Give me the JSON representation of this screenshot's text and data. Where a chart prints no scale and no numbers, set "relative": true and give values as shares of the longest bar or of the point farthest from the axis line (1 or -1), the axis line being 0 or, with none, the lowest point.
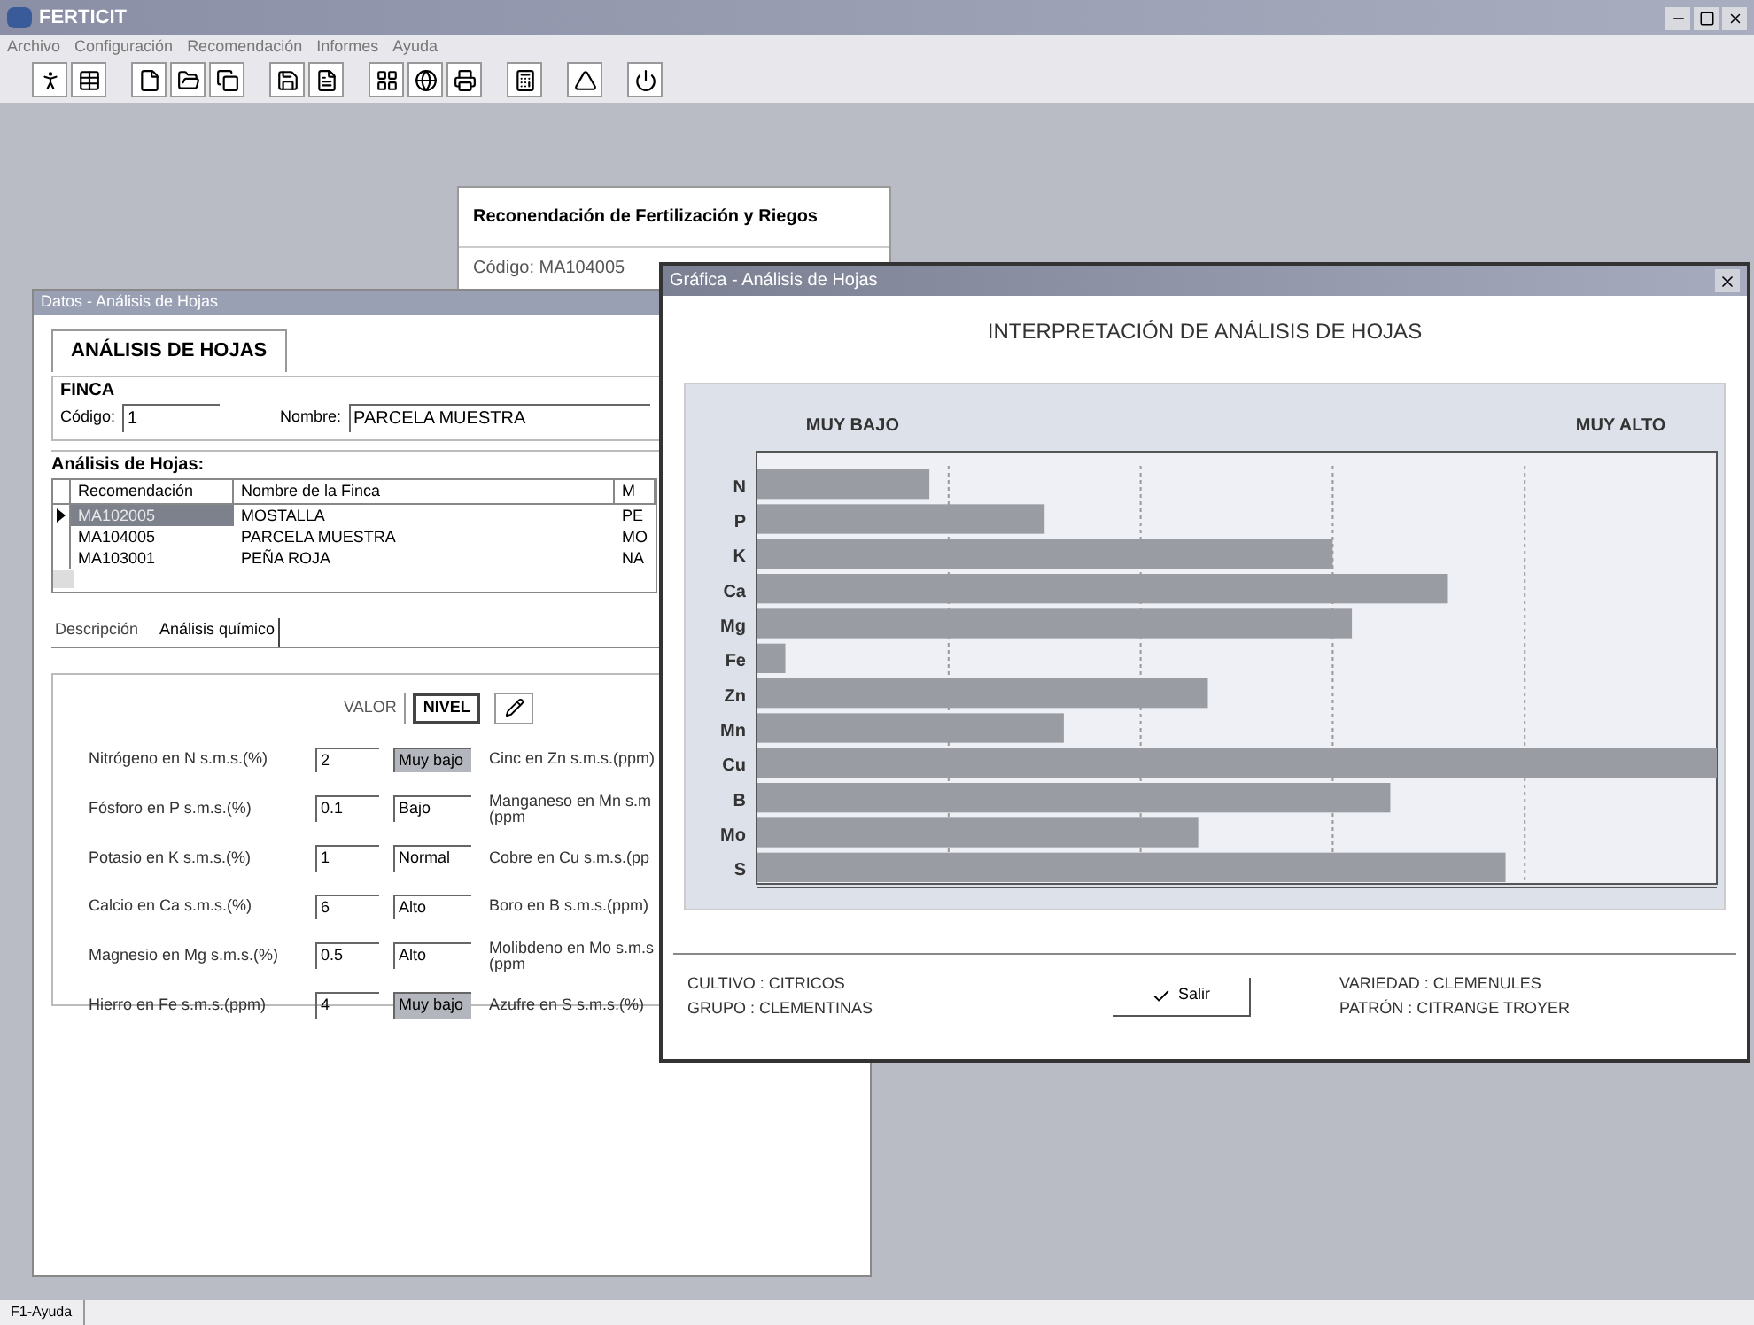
{
  "app": {
    "title": "FERTICIT",
    "menu": [
      "Archivo",
      "Configuración",
      "Recomendación",
      "Informes",
      "Ayuda"
    ]
  },
  "background_panel": {
    "title": "Reconendación de Fertilización y Riegos",
    "code_label": "Código: MA104005"
  },
  "data_window": {
    "title": "Datos - Análisis de Hojas",
    "header_tab": "ANÁLISIS DE HOJAS",
    "finca": {
      "legend": "FINCA",
      "code_label": "Código:",
      "code_value": "1",
      "name_label": "Nombre:",
      "name_value": "PARCELA MUESTRA"
    },
    "analyses": {
      "legend": "Análisis de Hojas:",
      "columns": [
        "Recomendación",
        "Nombre de la Finca",
        "M"
      ],
      "rows": [
        {
          "cells": [
            "MA102005",
            "MOSTALLA",
            "PE"
          ],
          "selected": true
        },
        {
          "cells": [
            "MA104005",
            "PARCELA MUESTRA",
            "MO"
          ],
          "selected": false
        },
        {
          "cells": [
            "MA103001",
            "PEÑA ROJA",
            "NA"
          ],
          "selected": false
        }
      ]
    },
    "tabs": [
      {
        "label": "Descripción",
        "selected": false
      },
      {
        "label": "Análisis químico",
        "selected": true
      }
    ],
    "column_buttons": [
      {
        "label": "VALOR",
        "pressed": false
      },
      {
        "label": "NIVEL",
        "pressed": true
      }
    ],
    "nutrients": [
      {
        "label": "Nitrógeno en N s.m.s.(%)",
        "value": "2",
        "level": "Muy bajo",
        "highlighted": true,
        "right_label": "Cinc en Zn s.m.s.(ppm)"
      },
      {
        "label": "Fósforo en P s.m.s.(%)",
        "value": "0.1",
        "level": "Bajo",
        "highlighted": false,
        "right_label": "Manganeso en Mn s.m (ppm"
      },
      {
        "label": "Potasio en K s.m.s.(%)",
        "value": "1",
        "level": "Normal",
        "highlighted": false,
        "right_label": "Cobre en Cu s.m.s.(pp"
      },
      {
        "label": "Calcio en Ca s.m.s.(%)",
        "value": "6",
        "level": "Alto",
        "highlighted": false,
        "right_label": "Boro en B s.m.s.(ppm)"
      },
      {
        "label": "Magnesio en Mg s.m.s.(%)",
        "value": "0.5",
        "level": "Alto",
        "highlighted": false,
        "right_label": "Molibdeno en Mo s.m.s (ppm"
      },
      {
        "label": "Hierro en Fe s.m.s.(ppm)",
        "value": "4",
        "level": "Muy bajo",
        "highlighted": true,
        "right_label": "Azufre en S s.m.s.(%)"
      }
    ]
  },
  "chart_window": {
    "title": "Gráfica - Análisis de Hojas",
    "heading": "INTERPRETACIÓN DE ANÁLISIS DE HOJAS",
    "chart_data": {
      "type": "bar",
      "orientation": "horizontal",
      "categories": [
        "N",
        "P",
        "K",
        "Ca",
        "Mg",
        "Fe",
        "Zn",
        "Mn",
        "Cu",
        "B",
        "Mo",
        "S"
      ],
      "series": [
        {
          "color": "#9a9ca4",
          "values": [
            0.18,
            0.3,
            0.6,
            0.72,
            0.62,
            0.03,
            0.47,
            0.32,
            1.0,
            0.66,
            0.46,
            0.78
          ]
        }
      ],
      "relative": true,
      "grid": true,
      "annotations": [
        "MUY BAJO",
        "MUY ALTO"
      ]
    },
    "info_left": [
      "CULTIVO : CITRICOS",
      "GRUPO : CLEMENTINAS"
    ],
    "exit_button": "Salir",
    "info_right": [
      "VARIEDAD : CLEMENULES",
      "PATRÓN : CITRANGE TROYER"
    ]
  },
  "status_bar": "F1-Ayuda"
}
